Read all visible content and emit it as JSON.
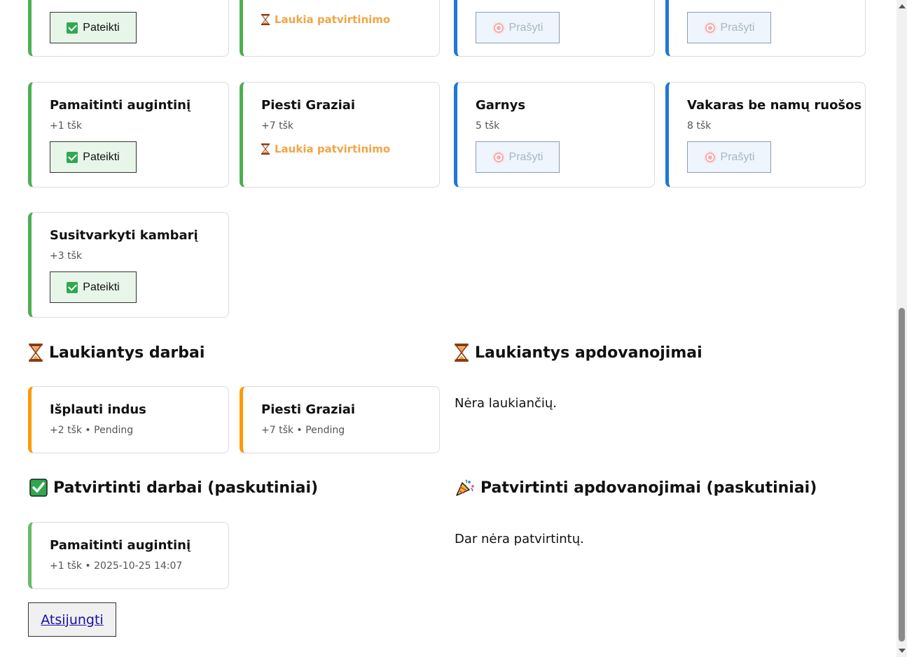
{
  "chores": [
    {
      "action": "Pateikti",
      "state": "submit"
    },
    {
      "status": "Laukia patvirtinimo",
      "state": "pending"
    },
    {
      "title": "Pamaitinti augintinį",
      "points": "+1 tšk",
      "action": "Pateikti"
    },
    {
      "title": "Piesti Graziai",
      "points": "+7 tšk",
      "status": "Laukia patvirtinimo"
    },
    {
      "title": "Susitvarkyti kambarį",
      "points": "+3 tšk",
      "action": "Pateikti"
    }
  ],
  "rewards": [
    {
      "action": "Prašyti"
    },
    {
      "action": "Prašyti"
    },
    {
      "title": "Garnys",
      "points": "5 tšk",
      "action": "Prašyti"
    },
    {
      "title": "Vakaras be namų ruošos",
      "points": "8 tšk",
      "action": "Prašyti"
    }
  ],
  "pending_work": {
    "title": "Laukiantys darbai",
    "icon": "hourglass-icon",
    "items": [
      {
        "title": "Išplauti indus",
        "meta": "+2 tšk • Pending"
      },
      {
        "title": "Piesti Graziai",
        "meta": "+7 tšk • Pending"
      }
    ]
  },
  "pending_rewards": {
    "title": "Laukiantys apdovanojimai",
    "icon": "hourglass-icon",
    "empty": "Nėra laukiančių."
  },
  "approved_work": {
    "title": "Patvirtinti darbai (paskutiniai)",
    "icon": "check-mark-icon",
    "items": [
      {
        "title": "Pamaitinti augintinį",
        "meta": "+1 tšk • 2025-10-25 14:07"
      }
    ]
  },
  "approved_rewards": {
    "title": "Patvirtinti apdovanojimai (paskutiniai)",
    "icon": "party-popper-icon",
    "empty": "Dar nėra patvirtintų."
  },
  "logout": {
    "label": "Atsijungti"
  },
  "colors": {
    "chore_border": "#4caf50",
    "reward_border": "#1e78d6",
    "pending_border": "#ff9800",
    "pending_text": "#f0a646"
  }
}
